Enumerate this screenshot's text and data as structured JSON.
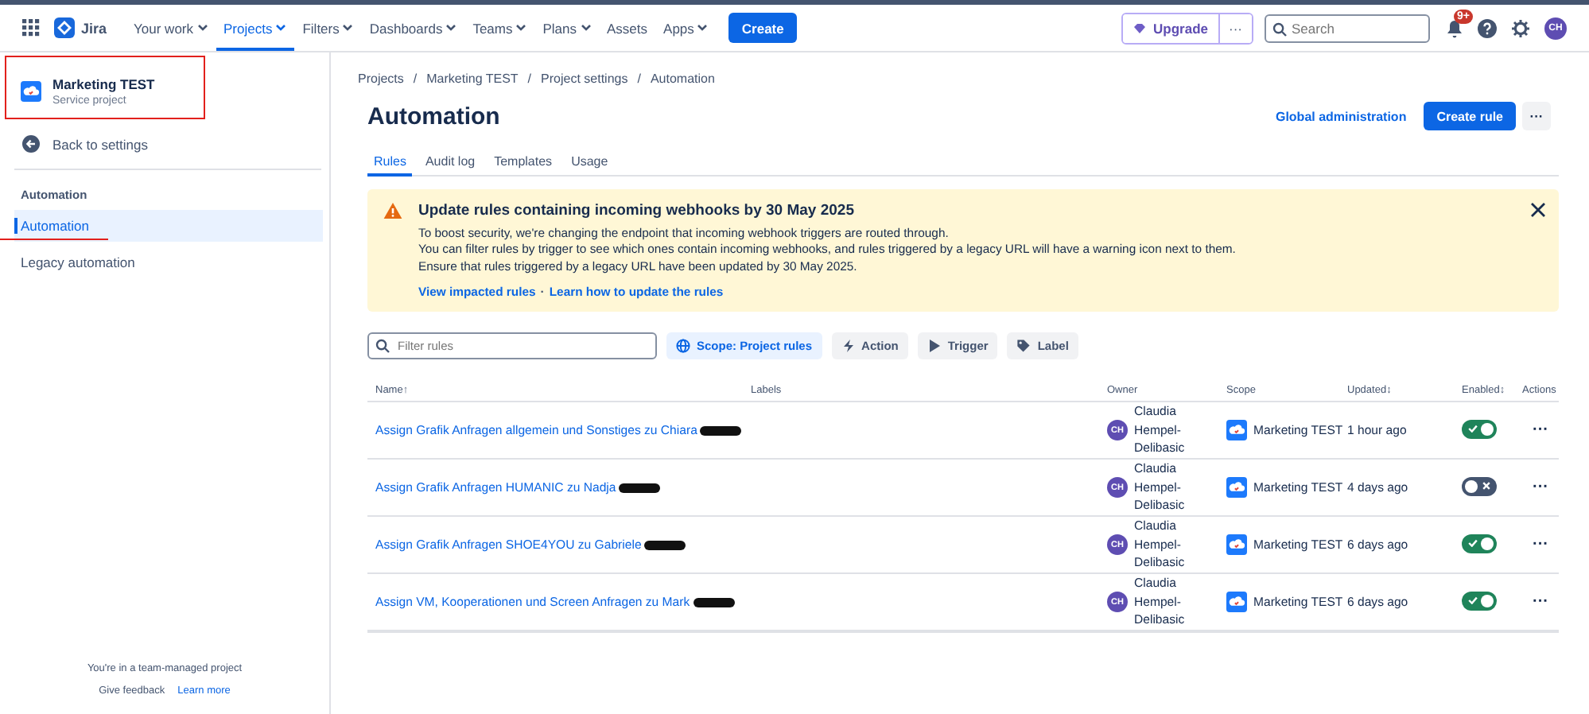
{
  "topbar": {
    "product": "Jira",
    "nav": [
      {
        "label": "Your work",
        "dropdown": true,
        "selected": false
      },
      {
        "label": "Projects",
        "dropdown": true,
        "selected": true
      },
      {
        "label": "Filters",
        "dropdown": true,
        "selected": false
      },
      {
        "label": "Dashboards",
        "dropdown": true,
        "selected": false
      },
      {
        "label": "Teams",
        "dropdown": true,
        "selected": false
      },
      {
        "label": "Plans",
        "dropdown": true,
        "selected": false
      },
      {
        "label": "Assets",
        "dropdown": false,
        "selected": false
      },
      {
        "label": "Apps",
        "dropdown": true,
        "selected": false
      }
    ],
    "create": "Create",
    "upgrade": "Upgrade",
    "more": "···",
    "search": {
      "placeholder": "Search"
    },
    "notifications": "9+",
    "avatar": "CH"
  },
  "sidebar": {
    "project": {
      "name": "Marketing TEST",
      "type": "Service project",
      "highlighted": true
    },
    "back": "Back to settings",
    "section": "Automation",
    "items": [
      {
        "label": "Automation",
        "selected": true,
        "underlined": true
      },
      {
        "label": "Legacy automation",
        "selected": false,
        "underlined": false
      }
    ],
    "footer": {
      "note": "You're in a team-managed project",
      "feedback": "Give feedback",
      "learn_more": "Learn more"
    }
  },
  "breadcrumbs": [
    "Projects",
    "Marketing TEST",
    "Project settings",
    "Automation"
  ],
  "breadcrumb_separator": "/",
  "title": "Automation",
  "actions": {
    "global": "Global administration",
    "create_rule": "Create rule",
    "more": "···"
  },
  "tabs": [
    {
      "label": "Rules",
      "selected": true
    },
    {
      "label": "Audit log",
      "selected": false
    },
    {
      "label": "Templates",
      "selected": false
    },
    {
      "label": "Usage",
      "selected": false
    }
  ],
  "banner": {
    "title": "Update rules containing incoming webhooks by 30 May 2025",
    "lines": [
      "To boost security, we're changing the endpoint that incoming webhook triggers are routed through.",
      "You can filter rules by trigger to see which ones contain incoming webhooks, and rules triggered by a legacy URL will have a warning icon next to them.",
      "Ensure that rules triggered by a legacy URL have been updated by 30 May 2025."
    ],
    "links": [
      "View impacted rules",
      "Learn how to update the rules"
    ],
    "link_separator": "·"
  },
  "filter": {
    "placeholder": "Filter rules"
  },
  "chips": [
    {
      "kind": "scope",
      "label": "Scope: Project rules",
      "selected": true
    },
    {
      "kind": "action",
      "label": "Action",
      "selected": false
    },
    {
      "kind": "trigger",
      "label": "Trigger",
      "selected": false
    },
    {
      "kind": "label",
      "label": "Label",
      "selected": false
    }
  ],
  "table": {
    "columns": [
      {
        "label": "Name",
        "sort": "↑"
      },
      {
        "label": "Labels"
      },
      {
        "label": "Owner"
      },
      {
        "label": "Scope"
      },
      {
        "label": "Updated",
        "sort": "↕"
      },
      {
        "label": "Enabled",
        "sort": "↕"
      },
      {
        "label": "Actions"
      }
    ],
    "rows": [
      {
        "name": "Assign Grafik Anfragen allgemein und Sonstiges zu Chiara",
        "redacted": true,
        "owner_initials": "CH",
        "owner": "Claudia Hempel-Delibasic",
        "scope": "Marketing TEST",
        "updated": "1 hour ago",
        "enabled": true,
        "more": "···"
      },
      {
        "name": "Assign Grafik Anfragen HUMANIC zu Nadja",
        "redacted": true,
        "owner_initials": "CH",
        "owner": "Claudia Hempel-Delibasic",
        "scope": "Marketing TEST",
        "updated": "4 days ago",
        "enabled": false,
        "more": "···"
      },
      {
        "name": "Assign Grafik Anfragen SHOE4YOU zu Gabriele",
        "redacted": true,
        "owner_initials": "CH",
        "owner": "Claudia Hempel-Delibasic",
        "scope": "Marketing TEST",
        "updated": "6 days ago",
        "enabled": true,
        "more": "···"
      },
      {
        "name": "Assign VM, Kooperationen und Screen Anfragen zu Mark",
        "redacted": true,
        "owner_initials": "CH",
        "owner": "Claudia Hempel-Delibasic",
        "scope": "Marketing TEST",
        "updated": "6 days ago",
        "enabled": true,
        "more": "···"
      }
    ]
  }
}
